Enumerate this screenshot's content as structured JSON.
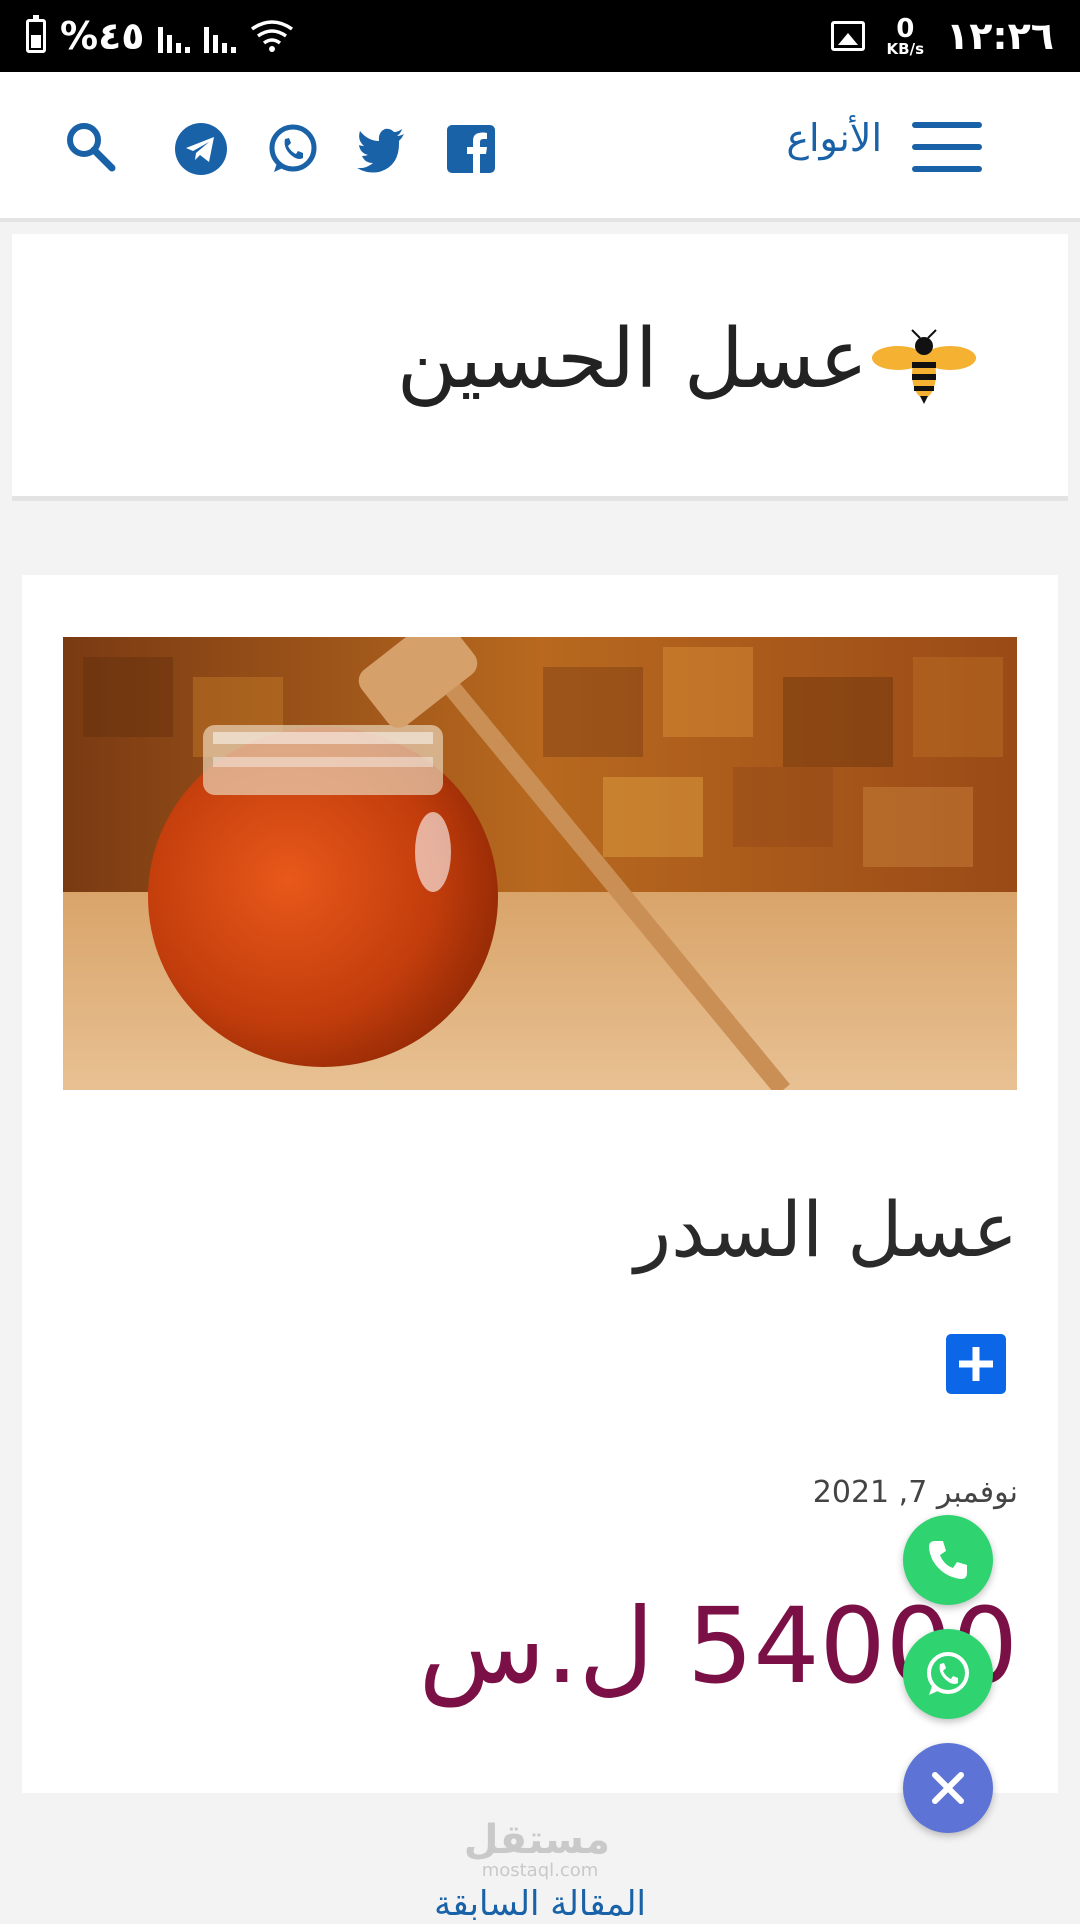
{
  "status_bar": {
    "battery": "%٤٥",
    "time": "١٢:٢٦",
    "net_speed_value": "0",
    "net_speed_unit": "KB/s"
  },
  "header": {
    "menu_label": "الأنواع",
    "icons": [
      "search-icon",
      "telegram-icon",
      "whatsapp-icon",
      "twitter-icon",
      "facebook-icon",
      "hamburger-menu-icon"
    ],
    "accent_color": "#1a62a8"
  },
  "site": {
    "title": "عسل الحسين",
    "logo_icon": "bee-icon"
  },
  "article": {
    "image_icon": "honey-jar-photo",
    "title": "عسل السدر",
    "share_icon": "plus-icon",
    "date": "نوفمبر 7, 2021",
    "price": "54000 ل.س",
    "price_color": "#7a1046"
  },
  "floating_actions": {
    "call_icon": "phone-icon",
    "whatsapp_icon": "whatsapp-icon",
    "close_icon": "close-icon"
  },
  "watermark": {
    "arabic": "مستقل",
    "latin": "mostaql.com"
  },
  "footer_nav": {
    "previous_article": "المقالة السابقة"
  }
}
